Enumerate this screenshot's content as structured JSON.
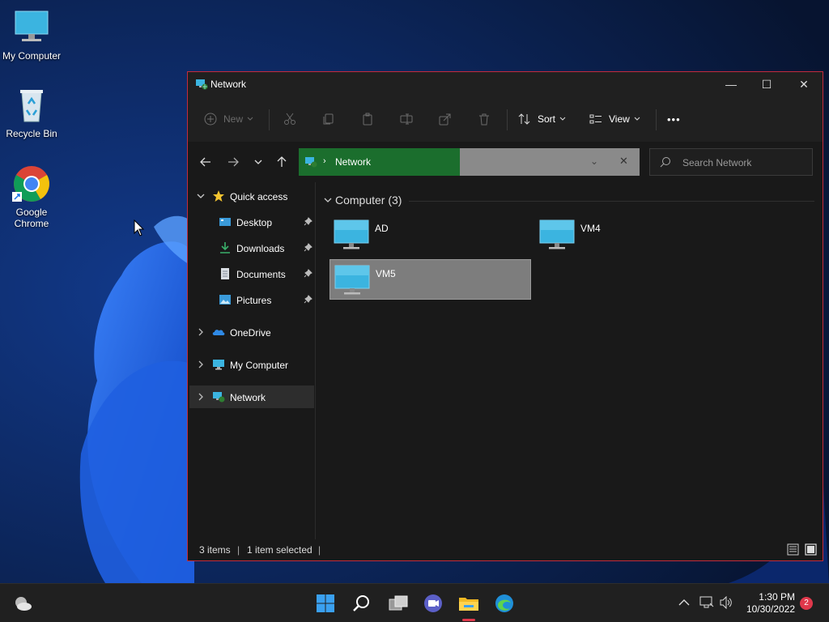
{
  "desktop": {
    "icons": [
      {
        "label": "My Computer"
      },
      {
        "label": "Recycle Bin"
      },
      {
        "label": "Google Chrome"
      }
    ]
  },
  "window": {
    "title": "Network",
    "controls": {
      "minimize": "—",
      "maximize": "☐",
      "close": "✕"
    }
  },
  "commandbar": {
    "new_label": "New",
    "sort_label": "Sort",
    "view_label": "View",
    "more_label": "•••"
  },
  "address": {
    "segment": "Network",
    "chevron": "›",
    "dropdown": "⌄",
    "clear": "✕"
  },
  "search": {
    "placeholder": "Search Network"
  },
  "navpane": {
    "items": [
      {
        "label": "Quick access"
      },
      {
        "label": "Desktop"
      },
      {
        "label": "Downloads"
      },
      {
        "label": "Documents"
      },
      {
        "label": "Pictures"
      },
      {
        "label": "OneDrive"
      },
      {
        "label": "My Computer"
      },
      {
        "label": "Network"
      }
    ]
  },
  "content": {
    "group_header": "Computer (3)",
    "items": [
      {
        "name": "AD"
      },
      {
        "name": "VM4"
      },
      {
        "name": "VM5"
      }
    ]
  },
  "status": {
    "item_count": "3 items",
    "selection": "1 item selected",
    "separator": "|"
  },
  "taskbar": {
    "time": "1:30 PM",
    "date": "10/30/2022",
    "notification_count": "2"
  },
  "colors": {
    "accent_border": "#c42b3c",
    "address_highlight": "#1b6e2d",
    "monitor_blue": "#3bb4e0"
  }
}
